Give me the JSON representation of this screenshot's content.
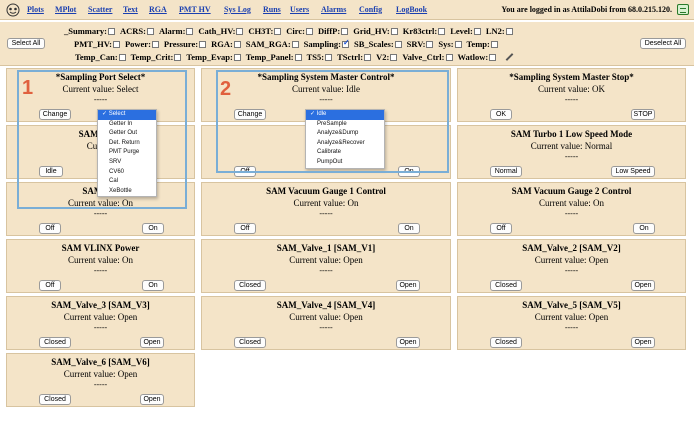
{
  "nav": {
    "links": [
      "Plots",
      "MPlot",
      "Scatter",
      "Text",
      "RGA",
      "PMT HV",
      "Sys Log",
      "Runs",
      "Users",
      "Alarms",
      "Config",
      "LogBook"
    ],
    "login_text": "You are logged in as AttilaDobi from 68.0.215.120."
  },
  "filters": {
    "select_all": "Select All",
    "deselect_all": "Deselect All",
    "rows": [
      [
        [
          "_Summary:",
          false
        ],
        [
          "ACRS:",
          false
        ],
        [
          "Alarm:",
          false
        ],
        [
          "Cath_HV:",
          false
        ],
        [
          "CH3T:",
          false
        ],
        [
          "Circ:",
          false
        ],
        [
          "DiffP:",
          false
        ],
        [
          "Grid_HV:",
          false
        ],
        [
          "Kr83ctrl:",
          false
        ],
        [
          "Level:",
          false
        ],
        [
          "LN2:",
          false
        ]
      ],
      [
        [
          "PMT_HV:",
          false
        ],
        [
          "Power:",
          false
        ],
        [
          "Pressure:",
          false
        ],
        [
          "RGA:",
          false
        ],
        [
          "SAM_RGA:",
          false
        ],
        [
          "Sampling:",
          true
        ],
        [
          "SB_Scales:",
          false
        ],
        [
          "SRV:",
          false
        ],
        [
          "Sys:",
          false
        ],
        [
          "Temp:",
          false
        ]
      ],
      [
        [
          "Temp_Can:",
          false
        ],
        [
          "Temp_Crit:",
          false
        ],
        [
          "Temp_Evap:",
          false
        ],
        [
          "Temp_Panel:",
          false
        ],
        [
          "TS5:",
          false
        ],
        [
          "TSctrl:",
          false
        ],
        [
          "V2:",
          false
        ],
        [
          "Valve_Ctrl:",
          false
        ],
        [
          "Watlow:",
          false
        ]
      ]
    ]
  },
  "panels": [
    {
      "title": "*Sampling Port Select*",
      "value": "Current value: Select",
      "dash": "-----",
      "buttons": [
        "Change",
        ""
      ]
    },
    {
      "title": "*Sampling System Master Control*",
      "value": "Current value: Idle",
      "dash": "-----",
      "buttons": [
        "Change",
        ""
      ]
    },
    {
      "title": "*Sampling System Master Stop*",
      "value": "Current value: OK",
      "dash": "-----",
      "buttons": [
        "OK",
        "STOP"
      ]
    },
    {
      "title": "SAM Logic",
      "value": "Current",
      "dash": "",
      "buttons": [
        "Idle",
        ""
      ]
    },
    {
      "title": "SAM",
      "value": "",
      "dash": "",
      "buttons": [
        "Off",
        "On"
      ]
    },
    {
      "title": "SAM Turbo 1 Low Speed Mode",
      "value": "Current value: Normal",
      "dash": "-----",
      "buttons": [
        "Normal",
        "Low Speed"
      ]
    },
    {
      "title": "SAM Tur",
      "value": "Current value: On",
      "dash": "-----",
      "buttons": [
        "Off",
        "On"
      ]
    },
    {
      "title": "SAM Vacuum Gauge 1 Control",
      "value": "Current value: On",
      "dash": "-----",
      "buttons": [
        "Off",
        "On"
      ]
    },
    {
      "title": "SAM Vacuum Gauge 2 Control",
      "value": "Current value: On",
      "dash": "-----",
      "buttons": [
        "Off",
        "On"
      ]
    },
    {
      "title": "SAM VLINX Power",
      "value": "Current value: On",
      "dash": "-----",
      "buttons": [
        "Off",
        "On"
      ]
    },
    {
      "title": "SAM_Valve_1 [SAM_V1]",
      "value": "Current value: Open",
      "dash": "-----",
      "buttons": [
        "Closed",
        "Open"
      ]
    },
    {
      "title": "SAM_Valve_2 [SAM_V2]",
      "value": "Current value: Open",
      "dash": "-----",
      "buttons": [
        "Closed",
        "Open"
      ]
    },
    {
      "title": "SAM_Valve_3 [SAM_V3]",
      "value": "Current value: Open",
      "dash": "-----",
      "buttons": [
        "Closed",
        "Open"
      ]
    },
    {
      "title": "SAM_Valve_4 [SAM_V4]",
      "value": "Current value: Open",
      "dash": "-----",
      "buttons": [
        "Closed",
        "Open"
      ]
    },
    {
      "title": "SAM_Valve_5 [SAM_V5]",
      "value": "Current value: Open",
      "dash": "-----",
      "buttons": [
        "Closed",
        "Open"
      ]
    },
    {
      "title": "SAM_Valve_6 [SAM_V6]",
      "value": "Current value: Open",
      "dash": "-----",
      "buttons": [
        "Closed",
        "Open"
      ]
    }
  ],
  "menu_port": {
    "selected": "Select",
    "items": [
      "Select",
      "Getter In",
      "Getter Out",
      "Det. Return",
      "PMT Purge",
      "SRV",
      "CV60",
      "Cal",
      "XeBottle"
    ]
  },
  "menu_master": {
    "selected": "Idle",
    "items": [
      "Idle",
      "PreSample",
      "Analyze&Dump",
      "Analyze&Recover",
      "Calibrate",
      "PumpOut"
    ]
  },
  "annotations": {
    "label_1": "1",
    "label_2": "2",
    "highlight_color": "#7aaed6",
    "label_color": "#e0603e"
  }
}
